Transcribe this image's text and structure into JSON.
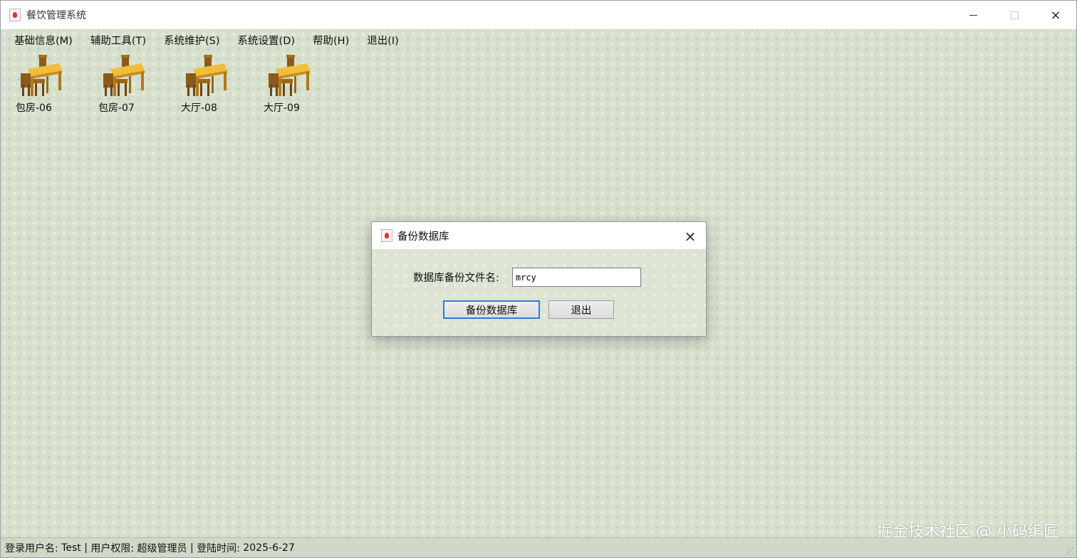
{
  "window": {
    "title": "餐饮管理系统",
    "controls": {
      "minimize": "minimize-icon",
      "maximize": "maximize-icon",
      "close": "×"
    }
  },
  "menubar": {
    "items": [
      {
        "label": "基础信息(M)"
      },
      {
        "label": "辅助工具(T)"
      },
      {
        "label": "系统维护(S)"
      },
      {
        "label": "系统设置(D)"
      },
      {
        "label": "帮助(H)"
      },
      {
        "label": "退出(I)"
      }
    ]
  },
  "tables": [
    {
      "label": "包房-06",
      "icon": "dining-table-icon"
    },
    {
      "label": "包房-07",
      "icon": "dining-table-icon"
    },
    {
      "label": "大厅-08",
      "icon": "dining-table-icon"
    },
    {
      "label": "大厅-09",
      "icon": "dining-table-icon"
    }
  ],
  "dialog": {
    "title": "备份数据库",
    "close": "×",
    "field_label": "数据库备份文件名:",
    "field_value": "mrcy",
    "backup_button": "备份数据库",
    "exit_button": "退出"
  },
  "statusbar": {
    "user_label": "登录用户名:",
    "user_value": "Test",
    "role_label": "用户权限:",
    "role_value": "超级管理员",
    "time_label": "登陆时间:",
    "time_value": "2025-6-27",
    "separator": "|"
  },
  "watermark": "掘金技术社区 @ 小码编匠",
  "colors": {
    "background": "#d7dfcd",
    "accent": "#2f7fd4",
    "titlebar": "#ffffff"
  }
}
